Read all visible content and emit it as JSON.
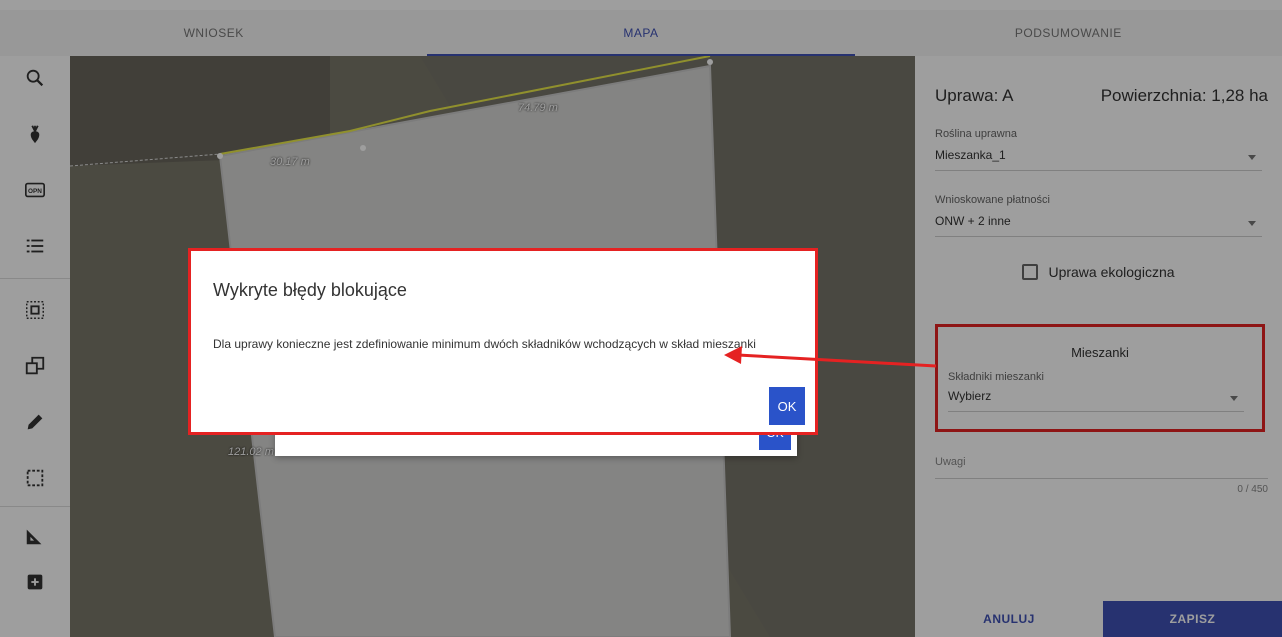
{
  "tabs": [
    {
      "label": "WNIOSEK"
    },
    {
      "label": "MAPA"
    },
    {
      "label": "PODSUMOWANIE"
    }
  ],
  "toolbar": {
    "tools": [
      "search-icon",
      "crop-icon",
      "opn-icon",
      "list-icon",
      "select-area-icon",
      "copy-icon",
      "pencil-icon",
      "rectangle-select-icon",
      "measure-icon",
      "add-icon"
    ],
    "opn_label": "OPN"
  },
  "map": {
    "labels": [
      "74.79 m",
      "30.17 m",
      "121.02 m"
    ]
  },
  "panel": {
    "crop": "Uprawa: A",
    "area": "Powierzchnia: 1,28 ha",
    "plant_label": "Roślina uprawna",
    "plant_value": "Mieszanka_1",
    "payments_label": "Wnioskowane płatności",
    "payments_value": "ONW + 2 inne",
    "eco_label": "Uprawa ekologiczna",
    "mix_title": "Mieszanki",
    "mix_label": "Składniki mieszanki",
    "mix_value": "Wybierz",
    "notes_label": "Uwagi",
    "counter": "0 / 450",
    "cancel": "ANULUJ",
    "save": "ZAPISZ"
  },
  "dialog": {
    "title": "Wykryte błędy blokujące",
    "message": "Dla uprawy konieczne jest zdefiniowanie minimum dwóch składników wchodzących w skład mieszanki",
    "ok": "OK"
  },
  "dialog_back": {
    "ok": "OK"
  },
  "colors": {
    "accent": "#3f51b5",
    "ok_button": "#2a53c9",
    "highlight": "#e52222"
  }
}
